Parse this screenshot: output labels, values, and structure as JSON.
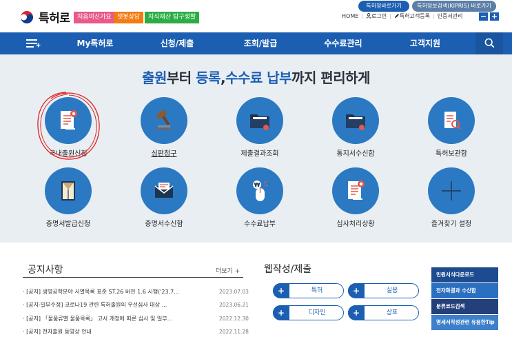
{
  "header": {
    "logo_text": "특허로",
    "tags": [
      "처음이신가요",
      "챗봇상담",
      "지식재산 탐구생활"
    ],
    "pills": [
      "특허청바로가기",
      "특허정보검색(KIPRIS) 바로가기"
    ],
    "util_links": [
      "HOME",
      "로그인",
      "특허고객등록",
      "인증서관리"
    ],
    "zoom_minus": "−",
    "zoom_plus": "+"
  },
  "nav": {
    "items": [
      "My특허로",
      "신청/제출",
      "조회/발급",
      "수수료관리",
      "고객지원"
    ]
  },
  "hero": {
    "title_parts": [
      "출원",
      "부터 ",
      "등록",
      ",",
      "수수료 납부",
      "까지 편리하게"
    ]
  },
  "services": [
    {
      "label": "국내출원신청",
      "icon": "document-ribbon-icon"
    },
    {
      "label": "심판청구",
      "icon": "gavel-icon"
    },
    {
      "label": "제출결과조회",
      "icon": "folder-icon"
    },
    {
      "label": "통지서수신함",
      "icon": "folder-icon"
    },
    {
      "label": "특허보관함",
      "icon": "document-search-icon"
    },
    {
      "label": "증명서발급신청",
      "icon": "book-icon"
    },
    {
      "label": "증명서수신함",
      "icon": "envelope-icon"
    },
    {
      "label": "수수료납부",
      "icon": "mouse-won-icon"
    },
    {
      "label": "심사처리상황",
      "icon": "document-ribbon-icon"
    },
    {
      "label": "즐겨찾기 설정",
      "icon": "plus-icon"
    }
  ],
  "notice": {
    "title": "공지사항",
    "more": "더보기 +",
    "rows": [
      {
        "text": "· [공지] 생명공학분야 서열목록 표준 ST.26 버전 1.6 시행('23.7...",
        "date": "2023.07.03"
      },
      {
        "text": "· [공지-일부수정] 코로나19 관련 특허출원의 우선심사 대상 ...",
        "date": "2023.06.21"
      },
      {
        "text": "· [공지] 「물품류별 물품목록」 고시 개정에 따른 심사 및 일부...",
        "date": "2022.12.30"
      },
      {
        "text": "· [공지] 전자출원 동영상 안내",
        "date": "2022.11.28"
      }
    ]
  },
  "forms": {
    "title": "웹작성/제출",
    "buttons": [
      "특허",
      "실용",
      "디자인",
      "상표"
    ],
    "plus": "+"
  },
  "side_links": [
    {
      "label": "민원서식다운로드",
      "color": "#1c4b8f"
    },
    {
      "label": "전자화결과 수신함",
      "color": "#2a6fc0"
    },
    {
      "label": "분류코드검색",
      "color": "#24407a"
    },
    {
      "label": "명세서작성관련 유용한Tip",
      "color": "#3d7fca"
    }
  ],
  "colors": {
    "brand": "#1c5fb2",
    "hero_bg": "#e9eef3",
    "circle": "#2b79c2",
    "annotation": "#e0201e"
  }
}
